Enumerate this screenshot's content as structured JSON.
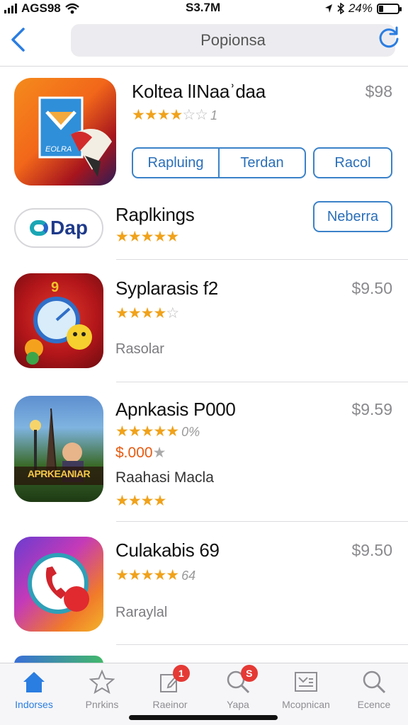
{
  "status": {
    "carrier": "AGS​98",
    "time": "S3.7M",
    "battery": "24%",
    "battery_level": 0.24
  },
  "nav": {
    "search_text": "Popionsa",
    "back_icon": "chevron-left-icon",
    "refresh_icon": "refresh-icon"
  },
  "apps": [
    {
      "title": "Koltea lINaaʾdaa",
      "price": "$98",
      "stars": "★★★★",
      "empty_stars": "☆☆",
      "rating_count": "1",
      "buttons": [
        "Rapluing",
        "Terdan",
        "Racol"
      ]
    },
    {
      "title": "Raplkings",
      "icon_text": "Dap",
      "stars": "★★★★★",
      "button": "Neberra"
    },
    {
      "title": "Syplarasis f2",
      "price": "$9.50",
      "stars": "★★★★",
      "empty_stars": "☆",
      "sub_label": "Rasolar"
    },
    {
      "title": "Apnkasis P000",
      "price": "$9.59",
      "stars": "★★★★★",
      "rating_count": "0%",
      "promo_price": "$.000",
      "promo_star": "★",
      "sub_label": "Raahasi Macla",
      "stars_2": "★★★★",
      "icon_text": "APRKEANIAR"
    },
    {
      "title": "Culakabis 69",
      "price": "$9.50",
      "stars": "★★★★★",
      "rating_count": "64",
      "sub_label": "Raraylal"
    }
  ],
  "tabs": [
    {
      "label": "Indorses",
      "icon": "home-icon",
      "active": true
    },
    {
      "label": "Pnrkins",
      "icon": "star-icon"
    },
    {
      "label": "Raeinor",
      "icon": "edit-icon",
      "badge": "1"
    },
    {
      "label": "Yapa",
      "icon": "search-icon",
      "badge": "S"
    },
    {
      "label": "Mcopnican",
      "icon": "news-icon"
    },
    {
      "label": "Ecence",
      "icon": "magnifier-icon"
    }
  ],
  "colors": {
    "accent": "#2a7de1",
    "star": "#f0a21a",
    "badge": "#e53935"
  }
}
